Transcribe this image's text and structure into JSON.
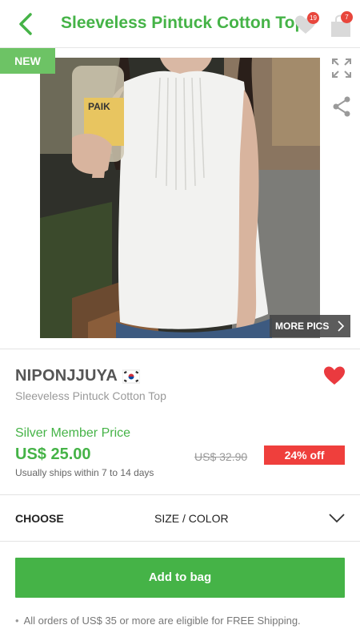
{
  "header": {
    "title": "Sleeveless Pintuck Cotton Top",
    "back_icon": "chevron-left-icon",
    "wishlist_icon": "heart-icon",
    "wishlist_count": "19",
    "bag_icon": "shopping-bag-icon",
    "bag_count": "7"
  },
  "gallery": {
    "tag": "NEW",
    "expand_icon": "expand-icon",
    "share_icon": "share-icon",
    "more_pics_label": "MORE PICS",
    "more_pics_icon": "chevron-right-icon"
  },
  "product": {
    "brand": "NIPONJJUYA",
    "flag_icon": "south-korea-flag-icon",
    "favorite_icon": "heart-icon",
    "name": "Sleeveless Pintuck Cotton Top",
    "member_price_label": "Silver Member Price",
    "price": "US$ 25.00",
    "original_price": "US$ 32.90",
    "discount": "24% off",
    "shipping_note": "Usually ships within 7 to 14 days"
  },
  "options": {
    "choose_label": "CHOOSE",
    "choose_value": "SIZE / COLOR",
    "dropdown_icon": "chevron-down-icon"
  },
  "cta": {
    "add_to_bag_label": "Add to bag"
  },
  "notice": {
    "free_shipping": "All orders of US$ 35 or more are eligible for FREE Shipping."
  },
  "colors": {
    "brand_green": "#45b347",
    "new_tag_green": "#6dc365",
    "discount_red": "#ef3f3c",
    "favorite_red": "#ea3a3f",
    "badge_red": "#e8463c"
  }
}
